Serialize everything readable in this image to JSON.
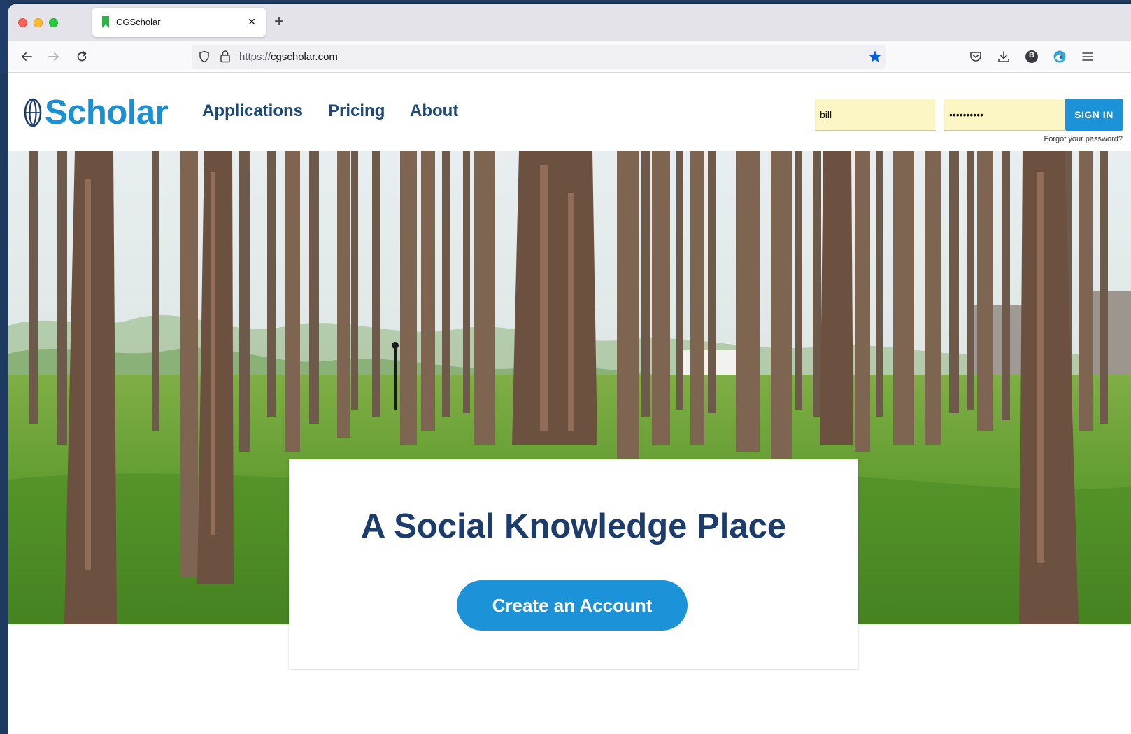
{
  "browser": {
    "tab_title": "CGScholar",
    "tab_close": "×",
    "new_tab": "+",
    "url_scheme": "https://",
    "url_host": "cgscholar.com",
    "profile_initial": "B"
  },
  "site": {
    "logo_text": "Scholar",
    "nav": [
      "Applications",
      "Pricing",
      "About"
    ],
    "login": {
      "username_value": "bill",
      "password_value": "••••••••••",
      "signin_label": "SIGN IN",
      "forgot_label": "Forgot your password?"
    },
    "hero": {
      "headline": "A Social Knowledge Place",
      "cta_label": "Create an Account"
    }
  },
  "colors": {
    "brand_blue": "#1c93d8",
    "nav_navy": "#1b4a7a",
    "headline_navy": "#1c3d6b",
    "autofill_yellow": "#fbf6c3"
  }
}
